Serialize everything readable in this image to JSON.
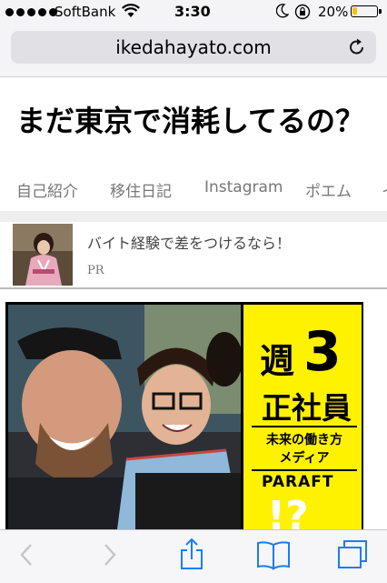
{
  "status": {
    "carrier": "SoftBank",
    "time": "3:30",
    "battery_percent": "20%",
    "battery_level": 0.2,
    "battery_color": "#f3c215"
  },
  "url_bar": {
    "domain": "ikedahayato.com",
    "reload_icon": "reload-icon"
  },
  "site": {
    "title": "まだ東京で消耗してるの？"
  },
  "nav": {
    "tabs": [
      "自己紹介",
      "移住日記",
      "Instagram",
      "ポエム",
      "イ"
    ]
  },
  "ad": {
    "headline": "バイト経験で差をつけるなら！",
    "label": "PR"
  },
  "banner": {
    "line1": "週",
    "line1_num": "3",
    "line2": "正社員",
    "sub1": "未来の働き方",
    "sub2": "メディア",
    "logo": "PARAFT",
    "partial": "!?",
    "accent": "#fff200"
  },
  "toolbar": {
    "icons": [
      "back-icon",
      "forward-icon",
      "share-icon",
      "bookmarks-icon",
      "tabs-icon"
    ],
    "tint": "#1a7cf5"
  }
}
